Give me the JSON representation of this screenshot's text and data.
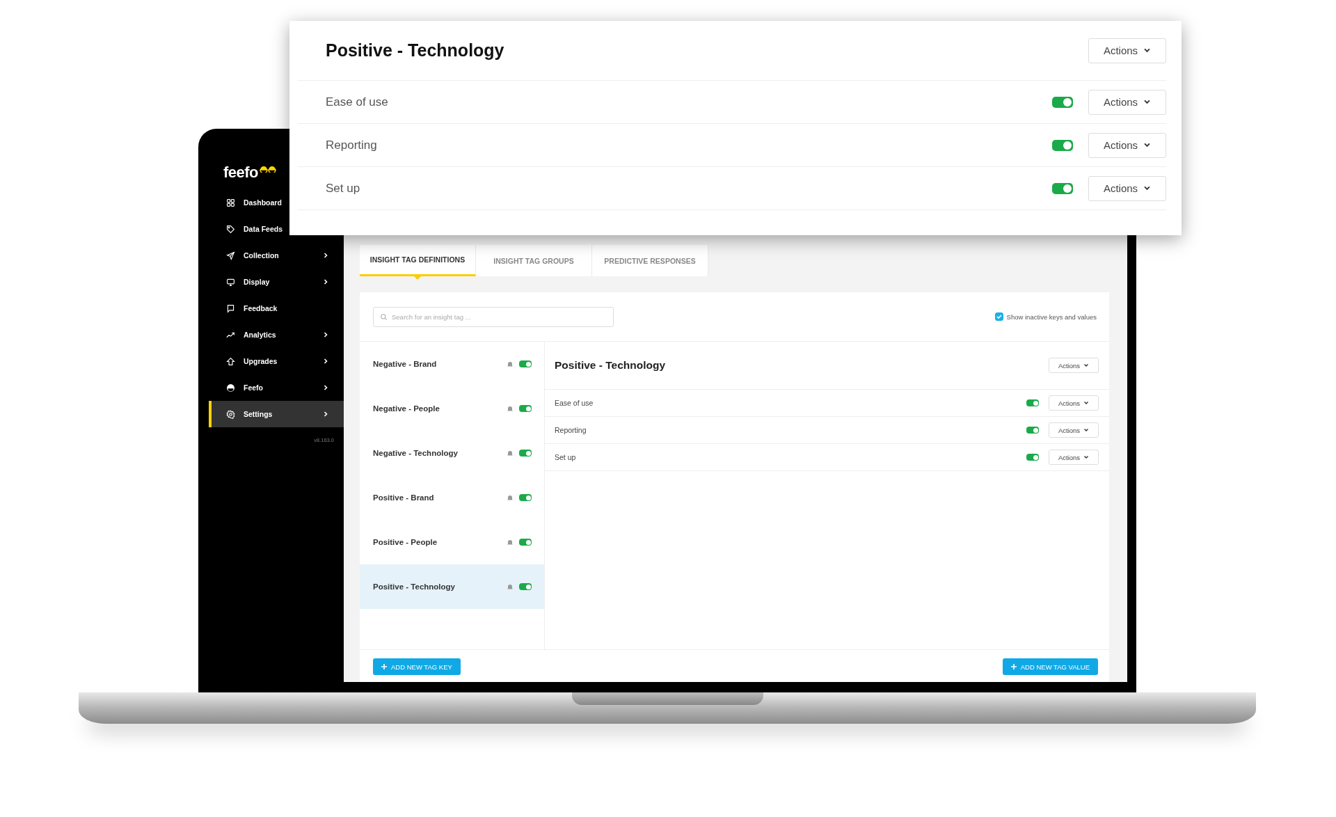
{
  "sidebar": {
    "logo": "feefo",
    "version": "v8.163.0",
    "items": [
      {
        "label": "Dashboard",
        "kind": "grid",
        "submenu": false,
        "selected": false
      },
      {
        "label": "Data Feeds",
        "kind": "tag",
        "submenu": false,
        "selected": false
      },
      {
        "label": "Collection",
        "kind": "send",
        "submenu": true,
        "selected": false
      },
      {
        "label": "Display",
        "kind": "monitor",
        "submenu": true,
        "selected": false
      },
      {
        "label": "Feedback",
        "kind": "chat",
        "submenu": false,
        "selected": false
      },
      {
        "label": "Analytics",
        "kind": "trend",
        "submenu": true,
        "selected": false
      },
      {
        "label": "Upgrades",
        "kind": "up",
        "submenu": true,
        "selected": false
      },
      {
        "label": "Feefo",
        "kind": "half",
        "submenu": true,
        "selected": false
      },
      {
        "label": "Settings",
        "kind": "gear",
        "submenu": true,
        "selected": true
      }
    ]
  },
  "tabs": [
    {
      "label": "INSIGHT TAG DEFINITIONS",
      "selected": true
    },
    {
      "label": "INSIGHT TAG GROUPS",
      "selected": false
    },
    {
      "label": "PREDICTIVE RESPONSES",
      "selected": false
    }
  ],
  "search": {
    "placeholder": "Search for an insight tag ..."
  },
  "show_inactive": {
    "label": "Show inactive keys and values",
    "checked": true
  },
  "tag_keys": [
    {
      "name": "Negative - Brand",
      "active": true,
      "selected": false
    },
    {
      "name": "Negative - People",
      "active": true,
      "selected": false
    },
    {
      "name": "Negative - Technology",
      "active": true,
      "selected": false
    },
    {
      "name": "Positive - Brand",
      "active": true,
      "selected": false
    },
    {
      "name": "Positive - People",
      "active": true,
      "selected": false
    },
    {
      "name": "Positive - Technology",
      "active": true,
      "selected": true
    }
  ],
  "detail": {
    "title": "Positive - Technology",
    "actions": "Actions",
    "values": [
      {
        "name": "Ease of use",
        "active": true,
        "actions": "Actions"
      },
      {
        "name": "Reporting",
        "active": true,
        "actions": "Actions"
      },
      {
        "name": "Set up",
        "active": true,
        "actions": "Actions"
      }
    ]
  },
  "buttons": {
    "add_key": "ADD NEW TAG KEY",
    "add_value": "ADD NEW TAG VALUE"
  },
  "zoom_card": {
    "title": "Positive - Technology",
    "actions": "Actions",
    "values": [
      {
        "name": "Ease of use",
        "active": true,
        "actions": "Actions"
      },
      {
        "name": "Reporting",
        "active": true,
        "actions": "Actions"
      },
      {
        "name": "Set up",
        "active": true,
        "actions": "Actions"
      }
    ]
  }
}
